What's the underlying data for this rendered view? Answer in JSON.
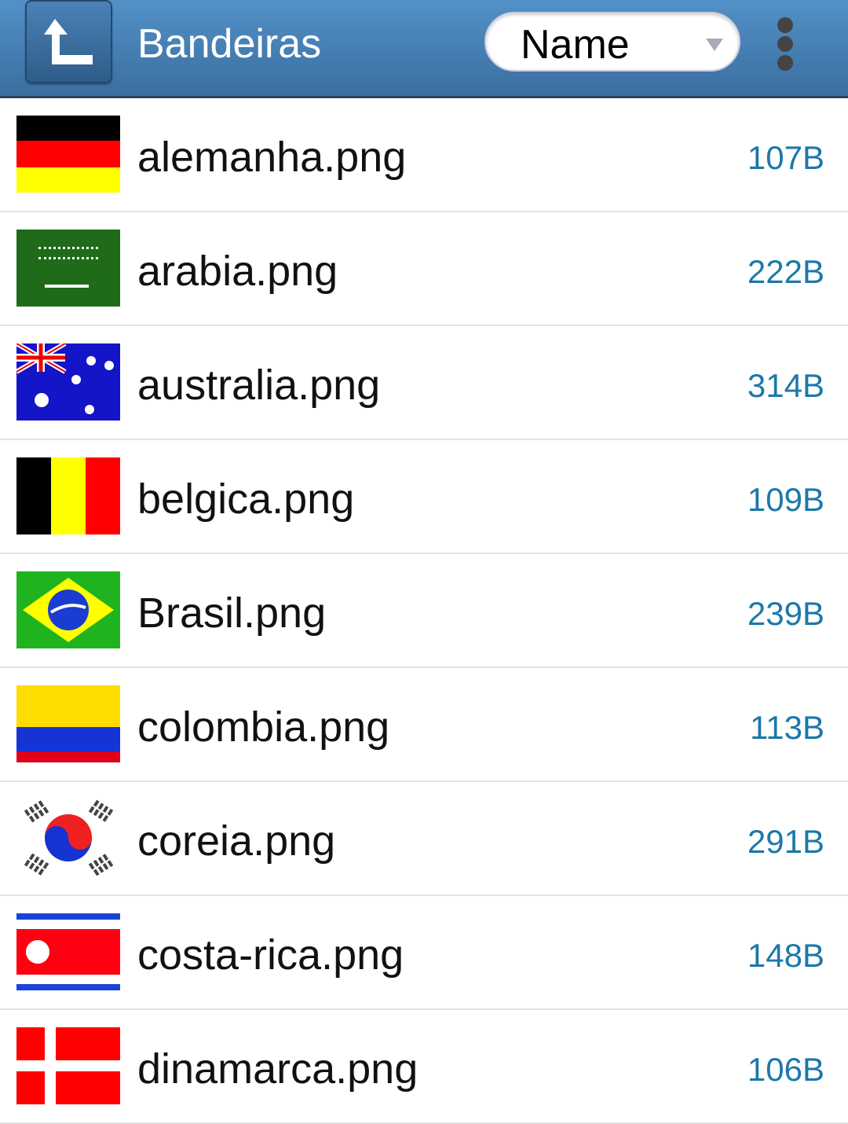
{
  "header": {
    "title": "Bandeiras",
    "sort_value": "Name"
  },
  "files": [
    {
      "name": "alemanha.png",
      "size": "107B",
      "flag": "germany"
    },
    {
      "name": "arabia.png",
      "size": "222B",
      "flag": "saudi-arabia"
    },
    {
      "name": "australia.png",
      "size": "314B",
      "flag": "australia"
    },
    {
      "name": "belgica.png",
      "size": "109B",
      "flag": "belgium"
    },
    {
      "name": "Brasil.png",
      "size": "239B",
      "flag": "brazil"
    },
    {
      "name": "colombia.png",
      "size": "113B",
      "flag": "colombia"
    },
    {
      "name": "coreia.png",
      "size": "291B",
      "flag": "korea"
    },
    {
      "name": "costa-rica.png",
      "size": "148B",
      "flag": "costa-rica"
    },
    {
      "name": "dinamarca.png",
      "size": "106B",
      "flag": "denmark"
    }
  ]
}
